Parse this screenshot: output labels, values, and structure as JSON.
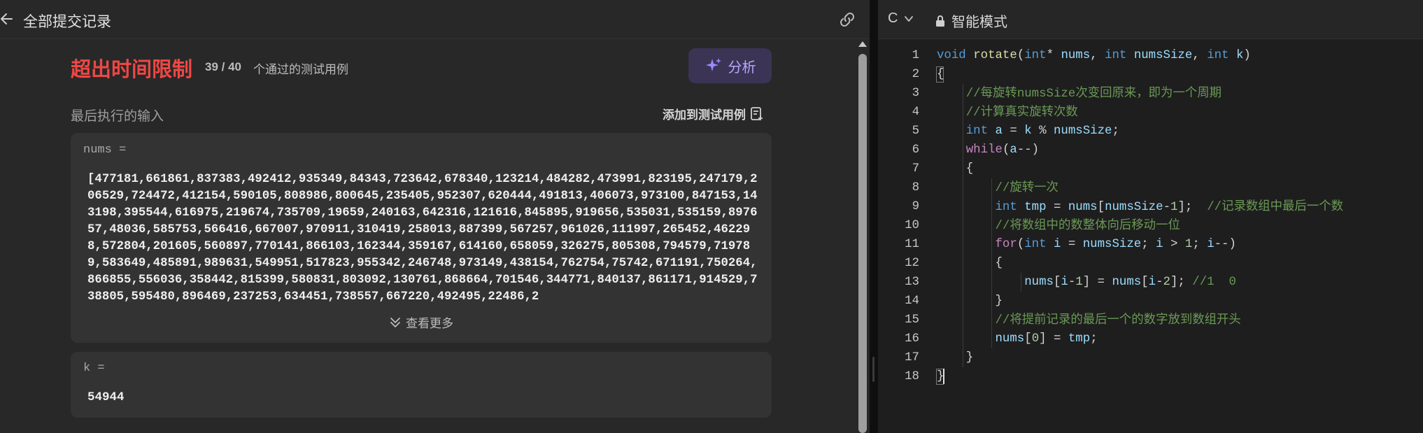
{
  "left_panel": {
    "header_title": "全部提交记录",
    "status_text": "超出时间限制",
    "passed_count": "39 / 40",
    "passed_label": "个通过的测试用例",
    "analyze_label": "分析",
    "last_input_label": "最后执行的输入",
    "add_testcase_label": "添加到测试用例",
    "inputs": {
      "nums_label": "nums =",
      "nums_value": "[477181,661861,837383,492412,935349,84343,723642,678340,123214,484282,473991,823195,247179,206529,724472,412154,590105,808986,800645,235405,952307,620444,491813,406073,973100,847153,143198,395544,616975,219674,735709,19659,240163,642316,121616,845895,919656,535031,535159,897657,48036,585753,566416,667007,970911,310419,258013,887399,567257,961026,111997,265452,462298,572804,201605,560897,770141,866103,162344,359167,614160,658059,326275,805308,794579,719789,583649,485891,989631,549951,517823,955342,246748,973149,438154,762754,75742,671191,750264,866855,556036,358442,815399,580831,803092,130761,868664,701546,344771,840137,861171,914529,738805,595480,896469,237253,634451,738557,667220,492495,22486,2",
      "see_more_label": "查看更多",
      "k_label": "k =",
      "k_value": "54944"
    },
    "icons": {
      "back": "arrow-left-icon",
      "link": "link-icon",
      "analyze": "sparkle-icon",
      "add_testcase": "add-to-list-icon",
      "see_more": "double-chevron-down-icon"
    },
    "colors": {
      "status_error": "#ef4743",
      "analyze_accent": "#b7a9ff"
    }
  },
  "right_panel": {
    "language": "C",
    "mode_label": "智能模式",
    "icons": {
      "language_dropdown": "chevron-down-icon",
      "mode": "lock-icon"
    },
    "code_lines": [
      {
        "n": "1",
        "text": "void rotate(int* nums, int numsSize, int k)"
      },
      {
        "n": "2",
        "text": "{"
      },
      {
        "n": "3",
        "text": "    //每旋转numsSize次变回原来，即为一个周期"
      },
      {
        "n": "4",
        "text": "    //计算真实旋转次数"
      },
      {
        "n": "5",
        "text": "    int a = k % numsSize;"
      },
      {
        "n": "6",
        "text": "    while(a--)"
      },
      {
        "n": "7",
        "text": "    {"
      },
      {
        "n": "8",
        "text": "        //旋转一次"
      },
      {
        "n": "9",
        "text": "        int tmp = nums[numsSize-1];  //记录数组中最后一个数"
      },
      {
        "n": "10",
        "text": "        //将数组中的数整体向后移动一位"
      },
      {
        "n": "11",
        "text": "        for(int i = numsSize; i > 1; i--)"
      },
      {
        "n": "12",
        "text": "        {"
      },
      {
        "n": "13",
        "text": "            nums[i-1] = nums[i-2]; //1  0"
      },
      {
        "n": "14",
        "text": "        }"
      },
      {
        "n": "15",
        "text": "        //将提前记录的最后一个的数字放到数组开头"
      },
      {
        "n": "16",
        "text": "        nums[0] = tmp;"
      },
      {
        "n": "17",
        "text": "    }"
      },
      {
        "n": "18",
        "text": "}"
      }
    ]
  }
}
